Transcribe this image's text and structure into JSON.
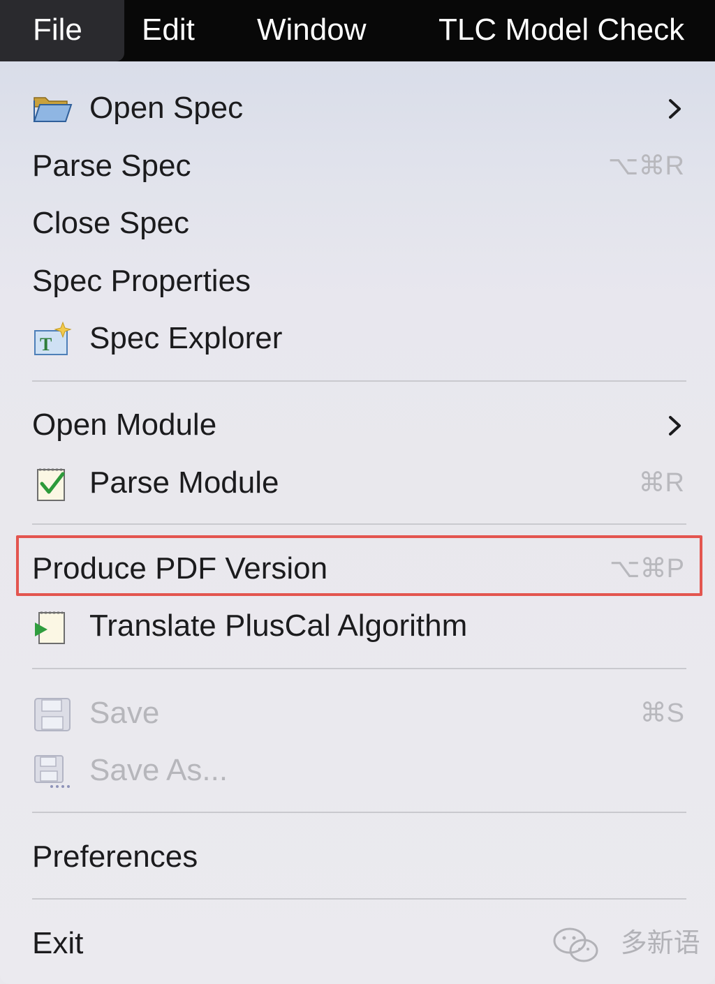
{
  "menubar": {
    "items": [
      {
        "label": "File",
        "active": true
      },
      {
        "label": "Edit"
      },
      {
        "label": "Window"
      },
      {
        "label": "TLC Model Check"
      }
    ]
  },
  "menu": {
    "open_spec": {
      "label": "Open Spec",
      "icon": "folder-open-icon",
      "submenu": true
    },
    "parse_spec": {
      "label": "Parse Spec",
      "shortcut": "⌥⌘R"
    },
    "close_spec": {
      "label": "Close Spec"
    },
    "spec_properties": {
      "label": "Spec Properties"
    },
    "spec_explorer": {
      "label": "Spec Explorer",
      "icon": "spec-explorer-icon"
    },
    "open_module": {
      "label": "Open Module",
      "submenu": true
    },
    "parse_module": {
      "label": "Parse Module",
      "shortcut": "⌘R",
      "icon": "checklist-icon"
    },
    "produce_pdf": {
      "label": "Produce PDF Version",
      "shortcut": "⌥⌘P",
      "highlighted": true
    },
    "translate_pluscal": {
      "label": "Translate PlusCal Algorithm",
      "icon": "translate-run-icon"
    },
    "save": {
      "label": "Save",
      "shortcut": "⌘S",
      "disabled": true,
      "icon": "save-icon"
    },
    "save_as": {
      "label": "Save As...",
      "disabled": true,
      "icon": "save-as-icon"
    },
    "preferences": {
      "label": "Preferences"
    },
    "exit": {
      "label": "Exit"
    }
  },
  "watermark": {
    "text": "多新语"
  },
  "colors": {
    "menubar_bg": "#080808",
    "menu_bg": "#e9e8ed",
    "highlight_border": "#e3554f",
    "disabled_text": "#b6b6bb"
  }
}
